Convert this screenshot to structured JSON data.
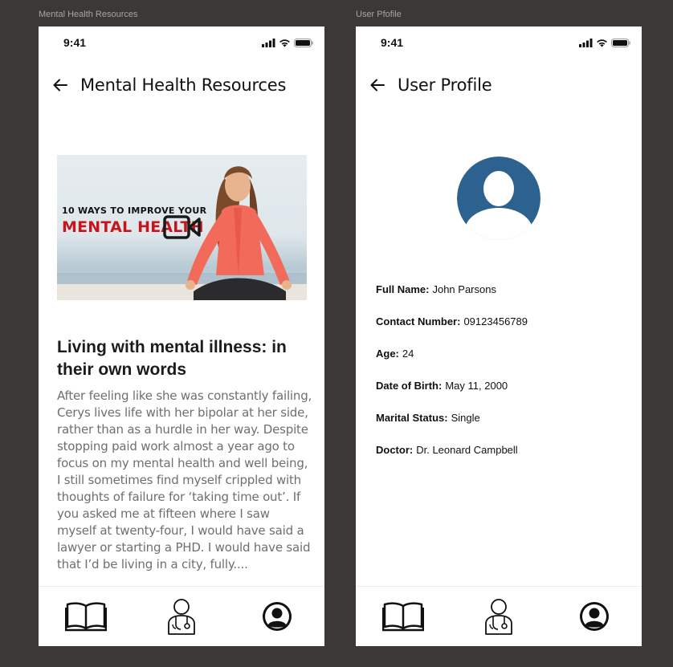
{
  "frames": [
    {
      "label": "Mental Health Resources"
    },
    {
      "label": "User Pfofile"
    }
  ],
  "status_bar": {
    "time": "9:41"
  },
  "resources_screen": {
    "title": "Mental Health Resources",
    "hero": {
      "line1": "10 WAYS TO IMPROVE YOUR",
      "line2": "MENTAL HEALTH"
    },
    "article_title": "Living with mental illness: in their own words",
    "article_body": "After feeling like she was constantly failing, Cerys lives life with her bipolar at her side, rather than as a hurdle in her way. Despite stopping paid work almost a year ago to focus on my mental health and well being, I still sometimes find myself crippled with thoughts of failure for ‘taking time out’. If you asked me at fifteen where I saw myself at twenty-four, I would have said a lawyer or starting a PHD. I would have said that I’d be living in a city, fully...."
  },
  "profile_screen": {
    "title": "User Profile",
    "fields": [
      {
        "label": "Full Name:",
        "value": " John Parsons"
      },
      {
        "label": "Contact Number:",
        "value": "09123456789"
      },
      {
        "label": "Age:",
        "value": "24"
      },
      {
        "label": "Date of Birth:",
        "value": "May 11, 2000"
      },
      {
        "label": "Marital Status:",
        "value": "Single"
      },
      {
        "label": "Doctor:",
        "value": "Dr. Leonard Campbell"
      }
    ]
  },
  "tab_bar": {
    "items": [
      {
        "icon": "book-icon"
      },
      {
        "icon": "doctor-icon"
      },
      {
        "icon": "profile-icon"
      }
    ]
  },
  "colors": {
    "background": "#3b3836",
    "avatar": "#2d6190",
    "hero_red": "#c7161b",
    "body_text": "#6f6f6f"
  }
}
